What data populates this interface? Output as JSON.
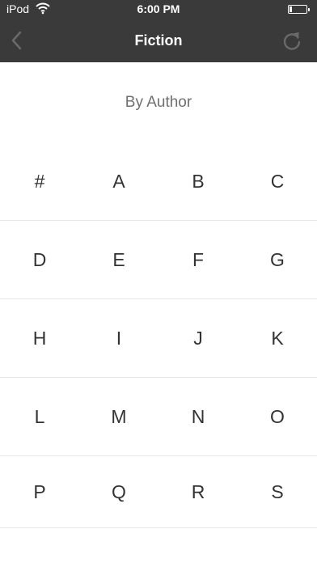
{
  "status_bar": {
    "carrier": "iPod",
    "time": "6:00 PM",
    "battery_level": 0.15
  },
  "nav": {
    "title": "Fiction",
    "back_icon": "chevron-left-icon",
    "refresh_icon": "refresh-icon"
  },
  "subtitle": "By Author",
  "index_rows": [
    [
      "#",
      "A",
      "B",
      "C"
    ],
    [
      "D",
      "E",
      "F",
      "G"
    ],
    [
      "H",
      "I",
      "J",
      "K"
    ],
    [
      "L",
      "M",
      "N",
      "O"
    ],
    [
      "P",
      "Q",
      "R",
      "S"
    ]
  ],
  "colors": {
    "nav_background": "#3a3a3a",
    "nav_text": "#ffffff",
    "nav_icon_disabled": "#6a6a6a",
    "subtitle_text": "#6f6f6f",
    "letter_text": "#333333",
    "divider": "#e8e8e8"
  }
}
